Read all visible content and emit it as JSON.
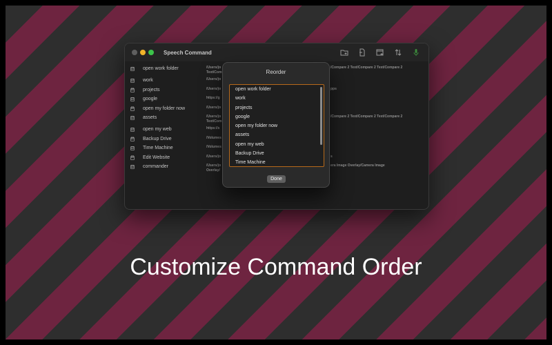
{
  "app": {
    "window_title": "Speech Command",
    "traffic_lights": {
      "close": "#5f5f5f",
      "minimize": "#f0b32a",
      "zoom": "#3cc34a"
    }
  },
  "toolbar": {
    "icons": [
      "folder-add-icon",
      "document-icon",
      "window-add-icon",
      "sort-arrows-icon",
      "microphone-icon"
    ],
    "mic_color": "#3c8a3c"
  },
  "commands": [
    {
      "name": "open work folder",
      "path": "/Users/jo",
      "path2": "Text/Com",
      "right": "/Compare 2 Text/Compare 2 Text/Compare 2",
      "checked": "☑"
    },
    {
      "name": "work",
      "path": "/Users/jo",
      "path2": "",
      "right": "",
      "checked": "☑"
    },
    {
      "name": "projects",
      "path": "/Users/jo",
      "path2": "",
      "right": "pps",
      "checked": "☑"
    },
    {
      "name": "google",
      "path": "https://g",
      "path2": "",
      "right": "",
      "checked": "☑"
    },
    {
      "name": "open my folder now",
      "path": "/Users/jo",
      "path2": "",
      "right": "",
      "checked": "☑"
    },
    {
      "name": "assets",
      "path": "/Users/jo",
      "path2": "Text/Com",
      "right": "/Compare 2 Text/Compare 2 Text/Compare 2",
      "checked": "☑"
    },
    {
      "name": "open my web",
      "path": "https://s",
      "path2": "",
      "right": "",
      "checked": "☑"
    },
    {
      "name": "Backup Drive",
      "path": "/Volumes",
      "path2": "",
      "right": "",
      "checked": "☑"
    },
    {
      "name": "Time Machine",
      "path": "/Volumes",
      "path2": "",
      "right": "",
      "checked": "☑"
    },
    {
      "name": "Edit Website",
      "path": "/Users/jo",
      "path2": "",
      "right": "s",
      "checked": "☑"
    },
    {
      "name": "commander",
      "path": "/Users/jo",
      "path2": "Overlay/",
      "right": "era Image Overlay/Camera Image",
      "checked": "☑"
    }
  ],
  "reorder_sheet": {
    "title": "Reorder",
    "items": [
      "open work folder",
      "work",
      "projects",
      "google",
      "open my folder now",
      "assets",
      "open my web",
      "Backup Drive",
      "Time Machine"
    ],
    "done_label": "Done"
  },
  "caption": "Customize Command Order",
  "colors": {
    "stripe_dark": "#2e2e2e",
    "stripe_magenta": "#6e2440",
    "list_border": "#b86a1a"
  }
}
